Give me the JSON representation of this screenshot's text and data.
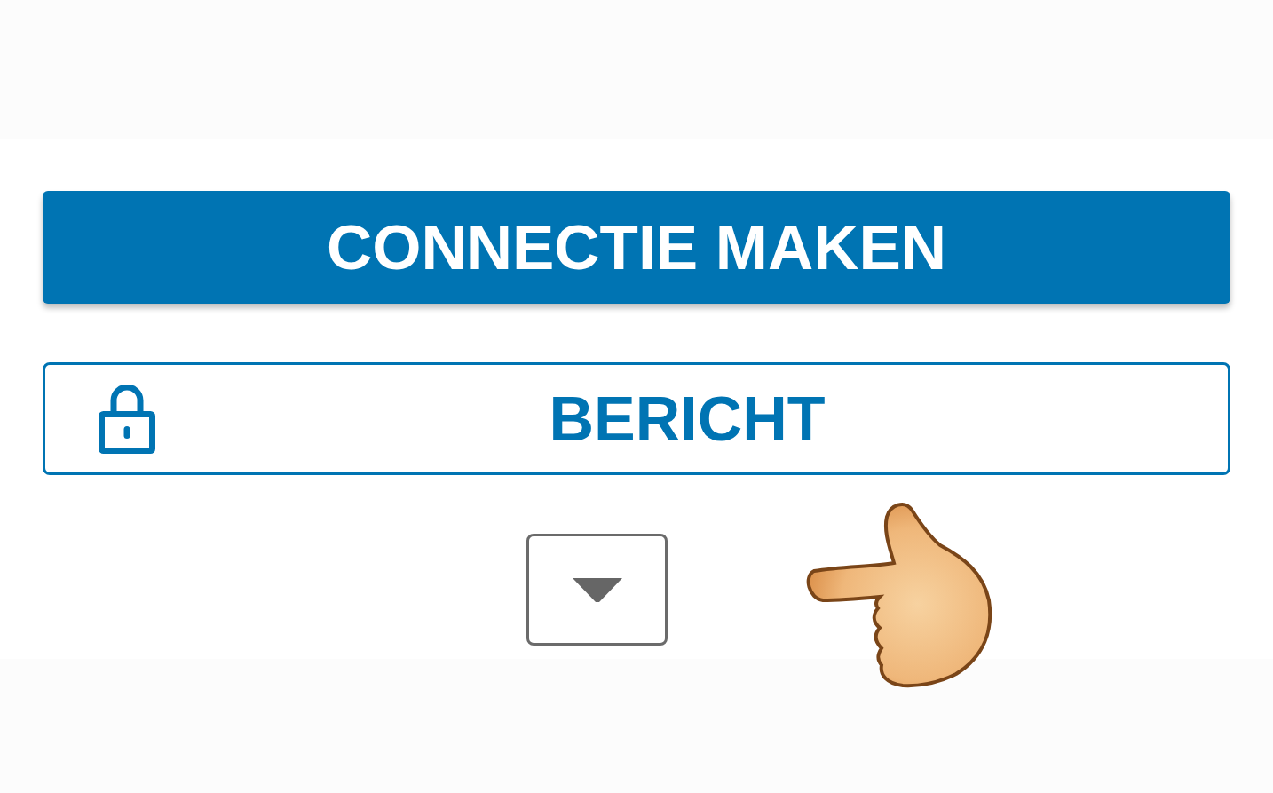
{
  "connect_button": {
    "label": "CONNECTIE MAKEN"
  },
  "message_button": {
    "label": "BERICHT"
  }
}
